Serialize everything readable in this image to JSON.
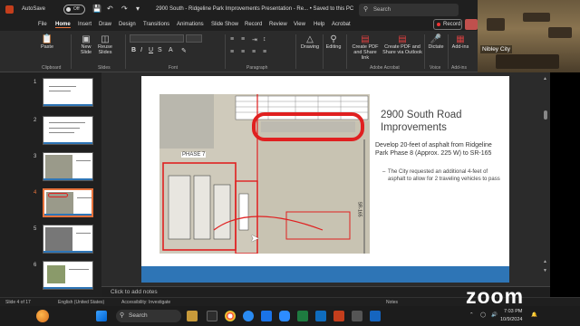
{
  "titlebar": {
    "autosave_label": "AutoSave",
    "autosave_state": "Off",
    "document_title": "2900 South - Ridgeline Park Improvements Presentation - Re... • Saved to this PC",
    "search_placeholder": "Search"
  },
  "menu": {
    "tabs": [
      "File",
      "Home",
      "Insert",
      "Draw",
      "Design",
      "Transitions",
      "Animations",
      "Slide Show",
      "Record",
      "Review",
      "View",
      "Help",
      "Acrobat"
    ],
    "active_tab": "Home"
  },
  "toolbar": {
    "record_label": "Record"
  },
  "ribbon": {
    "paste_label": "Paste",
    "new_slide_label": "New Slide",
    "reuse_slides_label": "Reuse Slides",
    "drawing_label": "Drawing",
    "editing_label": "Editing",
    "create_pdf_share_label": "Create PDF and Share link",
    "create_pdf_outlook_label": "Create PDF and Share via Outlook",
    "dictate_label": "Dictate",
    "addins_label": "Add-ins",
    "groups": {
      "clipboard": "Clipboard",
      "slides": "Slides",
      "font": "Font",
      "paragraph": "Paragraph",
      "adobe": "Adobe Acrobat",
      "voice": "Voice",
      "addins": "Add-ins"
    }
  },
  "video": {
    "participant_name": "Nibley City"
  },
  "thumbnails": {
    "numbers": [
      "1",
      "2",
      "3",
      "4",
      "5",
      "6"
    ],
    "active_index": 4
  },
  "slide": {
    "title": "2900 South Road Improvements",
    "body": "Develop 20-feet of asphalt from Ridgeline Park Phase 8 (Approx. 225 W) to SR-165",
    "sub_bullet": "The City requested an additional 4-feet of asphalt to allow for 2 traveling vehicles to pass",
    "map_phase_label": "PHASE 7",
    "map_road_label": "SR-165"
  },
  "notes": {
    "placeholder": "Click to add notes"
  },
  "statusbar": {
    "slide_counter": "Slide 4 of 17",
    "language": "English (United States)",
    "accessibility": "Accessibility: Investigate",
    "notes_label": "Notes"
  },
  "zoom_logo": "zoom",
  "taskbar": {
    "search_label": "Search",
    "time": "7:03 PM",
    "date": "10/9/2024"
  },
  "colors": {
    "accent_orange": "#e8733c",
    "slide_blue": "#2e75b6",
    "map_red": "#e02020"
  }
}
